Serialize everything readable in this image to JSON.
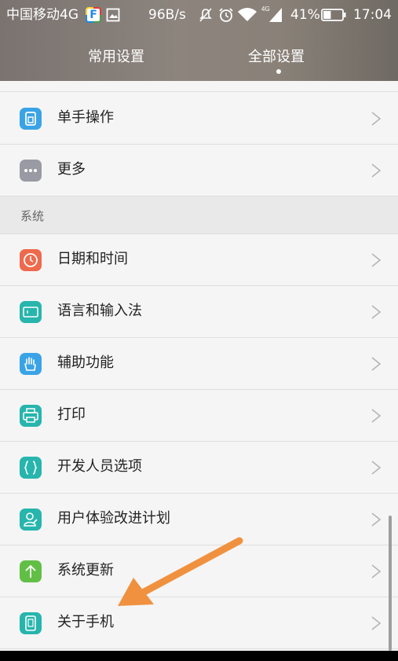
{
  "status_bar": {
    "carrier": "中国移动4G",
    "app_badge": "F",
    "net_speed": "96B/s",
    "signal_type": "4G",
    "battery_percent": "41%",
    "battery_level": 0.41,
    "time": "17:04"
  },
  "tabs": [
    {
      "label": "常用设置",
      "selected": false
    },
    {
      "label": "全部设置",
      "selected": true
    }
  ],
  "items_top": [
    {
      "label": "单手操作",
      "icon": "one-hand-icon",
      "color": "#3aa3e6"
    },
    {
      "label": "更多",
      "icon": "more-dots-icon",
      "color": "#9a9aa4"
    }
  ],
  "section_system": {
    "title": "系统"
  },
  "items_system": [
    {
      "label": "日期和时间",
      "icon": "clock-icon",
      "color": "#ee6a4d"
    },
    {
      "label": "语言和输入法",
      "icon": "keyboard-icon",
      "color": "#27b5ad"
    },
    {
      "label": "辅助功能",
      "icon": "hand-icon",
      "color": "#3aa3e6"
    },
    {
      "label": "打印",
      "icon": "printer-icon",
      "color": "#27b5ad"
    },
    {
      "label": "开发人员选项",
      "icon": "braces-icon",
      "color": "#27b5ad"
    },
    {
      "label": "用户体验改进计划",
      "icon": "user-feedback-icon",
      "color": "#27b5ad"
    },
    {
      "label": "系统更新",
      "icon": "update-arrow-icon",
      "color": "#62bf46"
    },
    {
      "label": "关于手机",
      "icon": "phone-icon",
      "color": "#27b5ad"
    }
  ],
  "colors": {
    "annotation_arrow": "#f0913f",
    "list_background": "#f5f5f5",
    "section_background": "#e9e9e9"
  }
}
